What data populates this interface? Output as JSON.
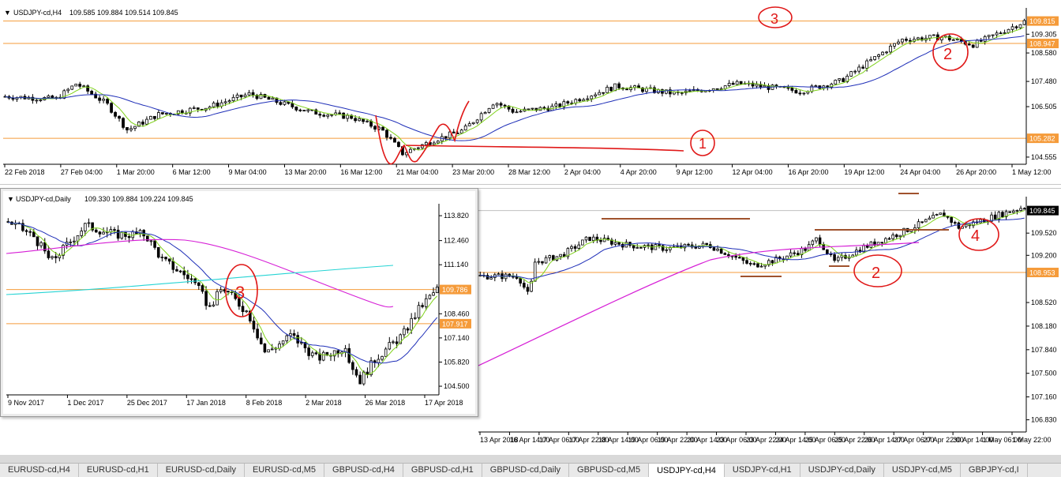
{
  "chart_data": [
    {
      "type": "line",
      "pane": "top",
      "title": "USDJPY-cd,H4",
      "ohlc_header": "109.585 109.884 109.514 109.845",
      "y_ticks": [
        "109.305",
        "108.580",
        "107.480",
        "106.505",
        "104.555"
      ],
      "price_tags": [
        {
          "label": "109.815",
          "y": 109.815,
          "color": "#f59b3a"
        },
        {
          "label": "108.947",
          "y": 108.947,
          "color": "#f59b3a"
        },
        {
          "label": "105.282",
          "y": 105.282,
          "color": "#f59b3a"
        }
      ],
      "ylim": [
        104.4,
        110.2
      ],
      "x_ticks": [
        "22 Feb 2018",
        "27 Feb 04:00",
        "1 Mar 20:00",
        "6 Mar 12:00",
        "9 Mar 04:00",
        "13 Mar 20:00",
        "16 Mar 12:00",
        "21 Mar 04:00",
        "23 Mar 20:00",
        "28 Mar 12:00",
        "2 Apr 04:00",
        "4 Apr 20:00",
        "9 Apr 12:00",
        "12 Apr 04:00",
        "16 Apr 20:00",
        "19 Apr 12:00",
        "24 Apr 04:00",
        "26 Apr 20:00",
        "1 May 12:00"
      ],
      "price_keypoints": [
        {
          "t": 0,
          "y": 106.9
        },
        {
          "t": 0.05,
          "y": 106.8
        },
        {
          "t": 0.07,
          "y": 107.4
        },
        {
          "t": 0.1,
          "y": 106.6
        },
        {
          "t": 0.12,
          "y": 105.6
        },
        {
          "t": 0.15,
          "y": 106.2
        },
        {
          "t": 0.2,
          "y": 106.5
        },
        {
          "t": 0.24,
          "y": 107.0
        },
        {
          "t": 0.3,
          "y": 106.3
        },
        {
          "t": 0.34,
          "y": 106.1
        },
        {
          "t": 0.37,
          "y": 105.6
        },
        {
          "t": 0.39,
          "y": 104.7
        },
        {
          "t": 0.42,
          "y": 105.2
        },
        {
          "t": 0.45,
          "y": 105.6
        },
        {
          "t": 0.48,
          "y": 106.7
        },
        {
          "t": 0.5,
          "y": 106.3
        },
        {
          "t": 0.54,
          "y": 106.5
        },
        {
          "t": 0.6,
          "y": 107.3
        },
        {
          "t": 0.66,
          "y": 107.0
        },
        {
          "t": 0.72,
          "y": 107.4
        },
        {
          "t": 0.78,
          "y": 107.1
        },
        {
          "t": 0.82,
          "y": 107.5
        },
        {
          "t": 0.85,
          "y": 108.3
        },
        {
          "t": 0.88,
          "y": 109.1
        },
        {
          "t": 0.92,
          "y": 109.2
        },
        {
          "t": 0.95,
          "y": 108.9
        },
        {
          "t": 1.0,
          "y": 109.8
        }
      ],
      "annotations": [
        "3",
        "2",
        "1"
      ]
    },
    {
      "type": "line",
      "pane": "daily",
      "title": "USDJPY-cd,Daily",
      "ohlc_header": "109.330 109.884 109.224 109.845",
      "y_ticks": [
        "113.820",
        "112.460",
        "111.140",
        "108.460",
        "107.140",
        "105.820",
        "104.500"
      ],
      "price_tags": [
        {
          "label": "109.786",
          "y": 109.786,
          "color": "#f59b3a"
        },
        {
          "label": "107.917",
          "y": 107.917,
          "color": "#f59b3a"
        }
      ],
      "ylim": [
        104.2,
        114.3
      ],
      "x_ticks": [
        "9 Nov 2017",
        "1 Dec 2017",
        "25 Dec 2017",
        "17 Jan 2018",
        "8 Feb 2018",
        "2 Mar 2018",
        "26 Mar 2018",
        "17 Apr 2018"
      ],
      "price_keypoints": [
        {
          "t": 0,
          "y": 113.5
        },
        {
          "t": 0.06,
          "y": 112.7
        },
        {
          "t": 0.1,
          "y": 111.3
        },
        {
          "t": 0.14,
          "y": 112.3
        },
        {
          "t": 0.18,
          "y": 113.3
        },
        {
          "t": 0.25,
          "y": 112.8
        },
        {
          "t": 0.32,
          "y": 112.8
        },
        {
          "t": 0.36,
          "y": 111.4
        },
        {
          "t": 0.43,
          "y": 110.3
        },
        {
          "t": 0.47,
          "y": 108.8
        },
        {
          "t": 0.5,
          "y": 109.9
        },
        {
          "t": 0.56,
          "y": 108.5
        },
        {
          "t": 0.6,
          "y": 106.3
        },
        {
          "t": 0.66,
          "y": 107.3
        },
        {
          "t": 0.72,
          "y": 106.0
        },
        {
          "t": 0.78,
          "y": 106.6
        },
        {
          "t": 0.82,
          "y": 104.8
        },
        {
          "t": 0.86,
          "y": 106.1
        },
        {
          "t": 0.92,
          "y": 107.3
        },
        {
          "t": 0.96,
          "y": 108.8
        },
        {
          "t": 1.0,
          "y": 109.8
        }
      ],
      "annotations": [
        "3"
      ]
    },
    {
      "type": "line",
      "pane": "bottom",
      "y_ticks": [
        "109.520",
        "109.200",
        "108.520",
        "108.180",
        "107.840",
        "107.500",
        "107.160",
        "106.830"
      ],
      "price_tags": [
        {
          "label": "109.845",
          "y": 109.845,
          "color": "#000000"
        },
        {
          "label": "108.953",
          "y": 108.953,
          "color": "#f59b3a"
        }
      ],
      "ylim": [
        106.7,
        110.0
      ],
      "x_ticks": [
        "13 Apr 2018",
        "16 Apr 14:00",
        "17 Apr 06:00",
        "17 Apr 22:00",
        "18 Apr 14:00",
        "19 Apr 06:00",
        "19 Apr 22:00",
        "20 Apr 14:00",
        "23 Apr 06:00",
        "23 Apr 22:00",
        "24 Apr 14:00",
        "25 Apr 06:00",
        "25 Apr 22:00",
        "26 Apr 14:00",
        "27 Apr 06:00",
        "27 Apr 22:00",
        "30 Apr 14:00",
        "1 May 06:00",
        "1 May 22:00"
      ],
      "price_keypoints": [
        {
          "t": 0,
          "y": 108.9
        },
        {
          "t": 0.07,
          "y": 108.9
        },
        {
          "t": 0.09,
          "y": 108.6
        },
        {
          "t": 0.1,
          "y": 109.1
        },
        {
          "t": 0.15,
          "y": 109.2
        },
        {
          "t": 0.2,
          "y": 109.45
        },
        {
          "t": 0.27,
          "y": 109.35
        },
        {
          "t": 0.34,
          "y": 109.3
        },
        {
          "t": 0.42,
          "y": 109.35
        },
        {
          "t": 0.5,
          "y": 109.05
        },
        {
          "t": 0.55,
          "y": 109.15
        },
        {
          "t": 0.6,
          "y": 109.3
        },
        {
          "t": 0.62,
          "y": 109.45
        },
        {
          "t": 0.65,
          "y": 109.1
        },
        {
          "t": 0.7,
          "y": 109.3
        },
        {
          "t": 0.78,
          "y": 109.55
        },
        {
          "t": 0.85,
          "y": 109.8
        },
        {
          "t": 0.88,
          "y": 109.6
        },
        {
          "t": 1.0,
          "y": 109.9
        }
      ],
      "annotations": [
        "4",
        "2"
      ]
    }
  ],
  "tabs": [
    {
      "label": "EURUSD-cd,H4",
      "active": false
    },
    {
      "label": "EURUSD-cd,H1",
      "active": false
    },
    {
      "label": "EURUSD-cd,Daily",
      "active": false
    },
    {
      "label": "EURUSD-cd,M5",
      "active": false
    },
    {
      "label": "GBPUSD-cd,H4",
      "active": false
    },
    {
      "label": "GBPUSD-cd,H1",
      "active": false
    },
    {
      "label": "GBPUSD-cd,Daily",
      "active": false
    },
    {
      "label": "GBPUSD-cd,M5",
      "active": false
    },
    {
      "label": "USDJPY-cd,H4",
      "active": true
    },
    {
      "label": "USDJPY-cd,H1",
      "active": false
    },
    {
      "label": "USDJPY-cd,Daily",
      "active": false
    },
    {
      "label": "USDJPY-cd,M5",
      "active": false
    },
    {
      "label": "GBPJPY-cd,I",
      "active": false
    }
  ],
  "colors": {
    "candle": "#000000",
    "ma_fast": "#7fd21a",
    "ma_mid": "#1f2fb8",
    "ma_slow": "#d61fd6",
    "ma_cyan": "#26d4d4",
    "level": "#f59b3a",
    "drawing": "#e01818",
    "trendline": "#a0522d"
  }
}
